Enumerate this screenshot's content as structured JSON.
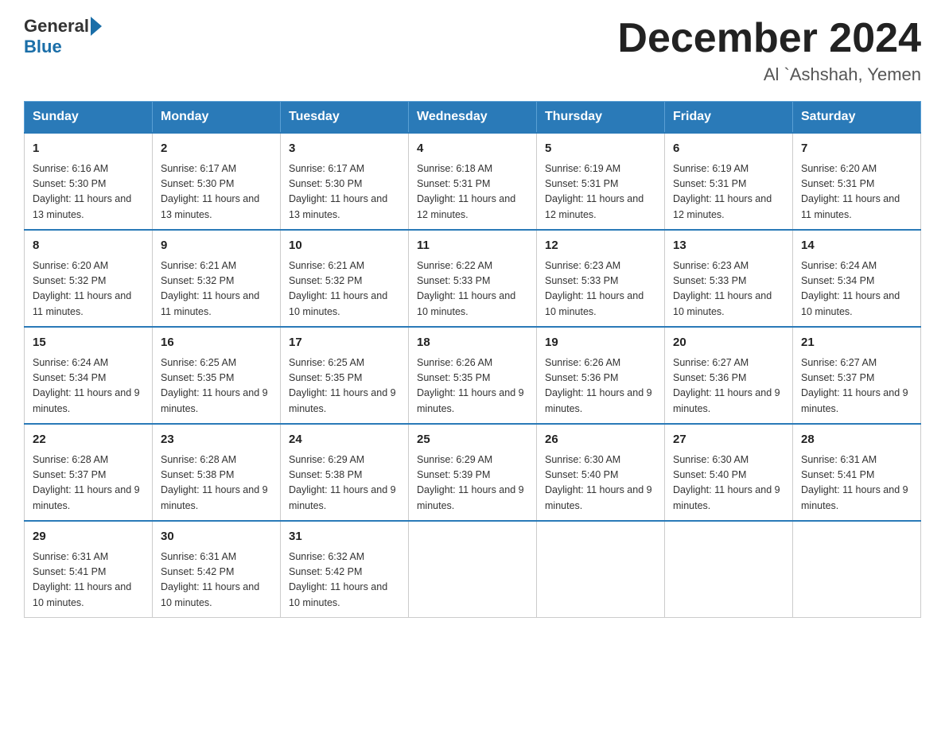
{
  "logo": {
    "general": "General",
    "blue": "Blue"
  },
  "title": "December 2024",
  "subtitle": "Al `Ashshah, Yemen",
  "days": [
    "Sunday",
    "Monday",
    "Tuesday",
    "Wednesday",
    "Thursday",
    "Friday",
    "Saturday"
  ],
  "weeks": [
    [
      {
        "day": "1",
        "sunrise": "6:16 AM",
        "sunset": "5:30 PM",
        "daylight": "11 hours and 13 minutes."
      },
      {
        "day": "2",
        "sunrise": "6:17 AM",
        "sunset": "5:30 PM",
        "daylight": "11 hours and 13 minutes."
      },
      {
        "day": "3",
        "sunrise": "6:17 AM",
        "sunset": "5:30 PM",
        "daylight": "11 hours and 13 minutes."
      },
      {
        "day": "4",
        "sunrise": "6:18 AM",
        "sunset": "5:31 PM",
        "daylight": "11 hours and 12 minutes."
      },
      {
        "day": "5",
        "sunrise": "6:19 AM",
        "sunset": "5:31 PM",
        "daylight": "11 hours and 12 minutes."
      },
      {
        "day": "6",
        "sunrise": "6:19 AM",
        "sunset": "5:31 PM",
        "daylight": "11 hours and 12 minutes."
      },
      {
        "day": "7",
        "sunrise": "6:20 AM",
        "sunset": "5:31 PM",
        "daylight": "11 hours and 11 minutes."
      }
    ],
    [
      {
        "day": "8",
        "sunrise": "6:20 AM",
        "sunset": "5:32 PM",
        "daylight": "11 hours and 11 minutes."
      },
      {
        "day": "9",
        "sunrise": "6:21 AM",
        "sunset": "5:32 PM",
        "daylight": "11 hours and 11 minutes."
      },
      {
        "day": "10",
        "sunrise": "6:21 AM",
        "sunset": "5:32 PM",
        "daylight": "11 hours and 10 minutes."
      },
      {
        "day": "11",
        "sunrise": "6:22 AM",
        "sunset": "5:33 PM",
        "daylight": "11 hours and 10 minutes."
      },
      {
        "day": "12",
        "sunrise": "6:23 AM",
        "sunset": "5:33 PM",
        "daylight": "11 hours and 10 minutes."
      },
      {
        "day": "13",
        "sunrise": "6:23 AM",
        "sunset": "5:33 PM",
        "daylight": "11 hours and 10 minutes."
      },
      {
        "day": "14",
        "sunrise": "6:24 AM",
        "sunset": "5:34 PM",
        "daylight": "11 hours and 10 minutes."
      }
    ],
    [
      {
        "day": "15",
        "sunrise": "6:24 AM",
        "sunset": "5:34 PM",
        "daylight": "11 hours and 9 minutes."
      },
      {
        "day": "16",
        "sunrise": "6:25 AM",
        "sunset": "5:35 PM",
        "daylight": "11 hours and 9 minutes."
      },
      {
        "day": "17",
        "sunrise": "6:25 AM",
        "sunset": "5:35 PM",
        "daylight": "11 hours and 9 minutes."
      },
      {
        "day": "18",
        "sunrise": "6:26 AM",
        "sunset": "5:35 PM",
        "daylight": "11 hours and 9 minutes."
      },
      {
        "day": "19",
        "sunrise": "6:26 AM",
        "sunset": "5:36 PM",
        "daylight": "11 hours and 9 minutes."
      },
      {
        "day": "20",
        "sunrise": "6:27 AM",
        "sunset": "5:36 PM",
        "daylight": "11 hours and 9 minutes."
      },
      {
        "day": "21",
        "sunrise": "6:27 AM",
        "sunset": "5:37 PM",
        "daylight": "11 hours and 9 minutes."
      }
    ],
    [
      {
        "day": "22",
        "sunrise": "6:28 AM",
        "sunset": "5:37 PM",
        "daylight": "11 hours and 9 minutes."
      },
      {
        "day": "23",
        "sunrise": "6:28 AM",
        "sunset": "5:38 PM",
        "daylight": "11 hours and 9 minutes."
      },
      {
        "day": "24",
        "sunrise": "6:29 AM",
        "sunset": "5:38 PM",
        "daylight": "11 hours and 9 minutes."
      },
      {
        "day": "25",
        "sunrise": "6:29 AM",
        "sunset": "5:39 PM",
        "daylight": "11 hours and 9 minutes."
      },
      {
        "day": "26",
        "sunrise": "6:30 AM",
        "sunset": "5:40 PM",
        "daylight": "11 hours and 9 minutes."
      },
      {
        "day": "27",
        "sunrise": "6:30 AM",
        "sunset": "5:40 PM",
        "daylight": "11 hours and 9 minutes."
      },
      {
        "day": "28",
        "sunrise": "6:31 AM",
        "sunset": "5:41 PM",
        "daylight": "11 hours and 9 minutes."
      }
    ],
    [
      {
        "day": "29",
        "sunrise": "6:31 AM",
        "sunset": "5:41 PM",
        "daylight": "11 hours and 10 minutes."
      },
      {
        "day": "30",
        "sunrise": "6:31 AM",
        "sunset": "5:42 PM",
        "daylight": "11 hours and 10 minutes."
      },
      {
        "day": "31",
        "sunrise": "6:32 AM",
        "sunset": "5:42 PM",
        "daylight": "11 hours and 10 minutes."
      },
      null,
      null,
      null,
      null
    ]
  ]
}
